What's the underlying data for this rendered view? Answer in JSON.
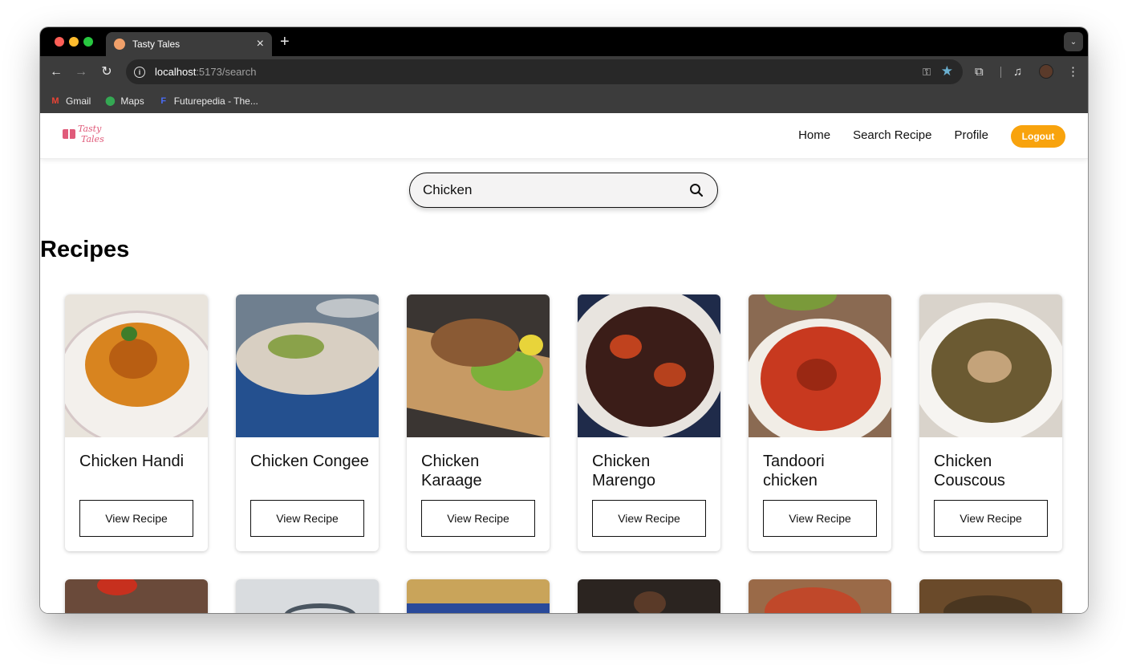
{
  "browser": {
    "tab_title": "Tasty Tales",
    "new_tab_symbol": "+",
    "url_host": "localhost",
    "url_path": ":5173/search",
    "bookmarks": [
      {
        "label": "Gmail",
        "icon": "gmail-icon"
      },
      {
        "label": "Maps",
        "icon": "maps-icon"
      },
      {
        "label": "Futurepedia - The...",
        "icon": "futurepedia-icon"
      }
    ]
  },
  "site": {
    "logo_line1": "Tasty",
    "logo_line2": "Tales",
    "nav": [
      "Home",
      "Search Recipe",
      "Profile"
    ],
    "logout_label": "Logout"
  },
  "search": {
    "value": "Chicken"
  },
  "section_title": "Recipes",
  "recipes": [
    {
      "title": "Chicken Handi",
      "button": "View Recipe"
    },
    {
      "title": "Chicken Congee",
      "button": "View Recipe"
    },
    {
      "title": "Chicken Karaage",
      "button": "View Recipe"
    },
    {
      "title": "Chicken Marengo",
      "button": "View Recipe"
    },
    {
      "title": "Tandoori chicken",
      "button": "View Recipe"
    },
    {
      "title": "Chicken Couscous",
      "button": "View Recipe"
    }
  ],
  "colors": {
    "accent": "#f8a30d",
    "logo": "#e05b7a",
    "chrome_dark": "#3c3c3c"
  }
}
